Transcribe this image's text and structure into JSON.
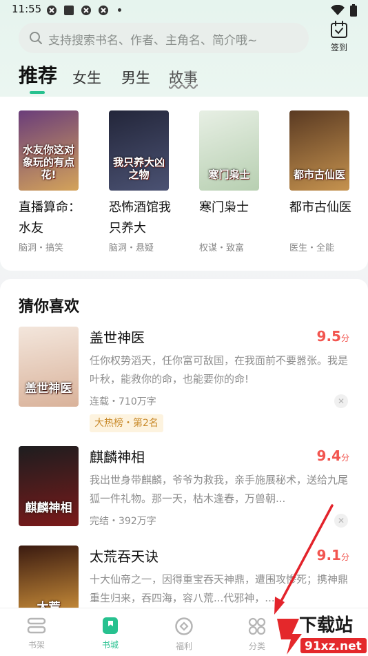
{
  "status": {
    "time": "11:55"
  },
  "search": {
    "placeholder": "支持搜索书名、作者、主角名、简介哦~"
  },
  "checkin": {
    "label": "签到"
  },
  "tabs": [
    "推荐",
    "女生",
    "男生",
    "故事"
  ],
  "recommend": [
    {
      "title": "直播算命：水友",
      "tags": "脑洞・搞笑",
      "cover_text": "水友你这对象玩的有点花!",
      "colors": [
        "#6a3d7a",
        "#d4a35a"
      ]
    },
    {
      "title": "恐怖酒馆我只养大",
      "tags": "脑洞・悬疑",
      "cover_text": "我只养大凶之物",
      "colors": [
        "#23263a",
        "#4b5273"
      ]
    },
    {
      "title": "寒门枭士",
      "tags": "权谋・致富",
      "cover_text": "寒门枭士",
      "colors": [
        "#e7efe4",
        "#b7cfb1"
      ]
    },
    {
      "title": "都市古仙医",
      "tags": "医生・全能",
      "cover_text": "都市古仙医",
      "colors": [
        "#5a3a22",
        "#c6934f"
      ]
    }
  ],
  "guess": {
    "heading": "猜你喜欢",
    "items": [
      {
        "title": "盖世神医",
        "score": "9.5",
        "score_unit": "分",
        "desc": "任你权势滔天，任你富可敌国，在我面前不要嚣张。我是叶秋，能救你的命，也能要你的命!",
        "meta": "连载・710万字",
        "rank": "大热榜・第2名",
        "cover_text": "盖世神医",
        "colors": [
          "#f3e6dc",
          "#d9b29a"
        ]
      },
      {
        "title": "麒麟神相",
        "score": "9.4",
        "score_unit": "分",
        "desc": "我出世身带麒麟，爷爷为救我，亲手施展秘术，送给九尾狐一件礼物。那一天，枯木逢春，万兽朝...",
        "meta": "完结・392万字",
        "rank": "",
        "cover_text": "麒麟神相",
        "colors": [
          "#1d1d1f",
          "#7a1a1a"
        ]
      },
      {
        "title": "太荒吞天诀",
        "score": "9.1",
        "score_unit": "分",
        "desc": "十大仙帝之一，因得重宝吞天神鼎，遭围攻惨死；携神鼎重生归来，吞四海，容八荒...代邪神，...",
        "meta": "",
        "rank": "",
        "cover_text": "太荒",
        "colors": [
          "#3a1a10",
          "#e0a040"
        ]
      }
    ]
  },
  "nav": [
    {
      "label": "书架",
      "icon": "bookshelf-icon",
      "active": false
    },
    {
      "label": "书城",
      "icon": "bookstore-icon",
      "active": true
    },
    {
      "label": "福利",
      "icon": "welfare-icon",
      "active": false
    },
    {
      "label": "分类",
      "icon": "category-icon",
      "active": false
    }
  ],
  "watermark": {
    "brand": "下载站",
    "site": "91xz.net"
  },
  "accent": "#27c18f",
  "score_color": "#f2554f"
}
